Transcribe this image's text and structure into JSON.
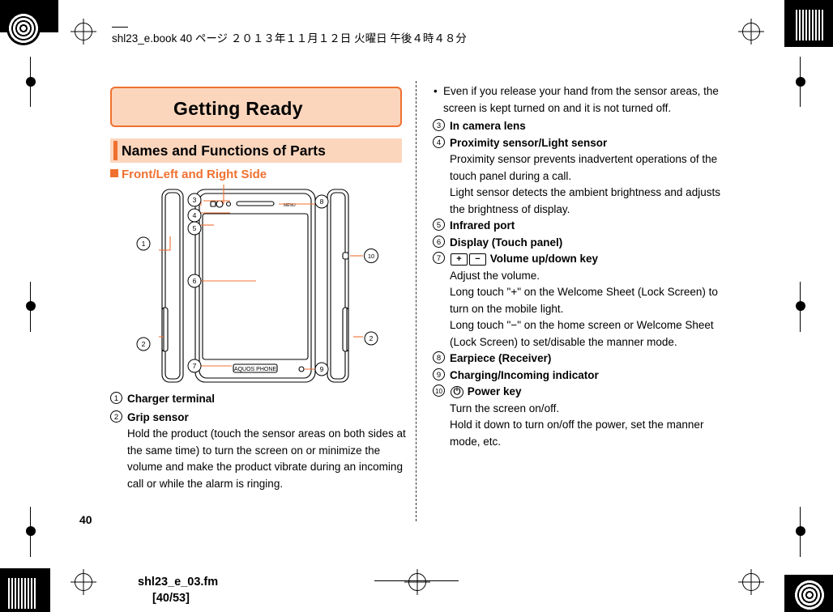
{
  "header": {
    "text": "shl23_e.book   40 ページ   ２０１３年１１月１２日   火曜日   午後４時４８分"
  },
  "chapter": {
    "title": "Getting Ready"
  },
  "section": {
    "title": "Names and Functions of Parts"
  },
  "subsection": {
    "title": "Front/Left and Right Side"
  },
  "figure": {
    "phone_label": "AQUOS PHONE",
    "callouts": [
      "1",
      "2",
      "3",
      "4",
      "5",
      "6",
      "7",
      "8",
      "9",
      "10"
    ]
  },
  "left_column": {
    "items": [
      {
        "num": "1",
        "title": "Charger terminal",
        "body": ""
      },
      {
        "num": "2",
        "title": "Grip sensor",
        "body": "Hold the product (touch the sensor areas on both sides at the same time) to turn the screen on or minimize the volume and make the product vibrate during an incoming call or while the alarm is ringing."
      }
    ]
  },
  "right_column": {
    "top_bullet": "Even if you release your hand from the sensor areas, the screen is kept turned on and it is not turned off.",
    "items": [
      {
        "num": "3",
        "title": "In camera lens",
        "lines": []
      },
      {
        "num": "4",
        "title": "Proximity sensor/Light sensor",
        "lines": [
          "Proximity sensor prevents inadvertent operations of the touch panel during a call.",
          "Light sensor detects the ambient brightness and adjusts the brightness of display."
        ]
      },
      {
        "num": "5",
        "title": "Infrared port",
        "lines": []
      },
      {
        "num": "6",
        "title": "Display (Touch panel)",
        "lines": []
      },
      {
        "num": "7",
        "title": "Volume up/down key",
        "keys": [
          "+",
          "−"
        ],
        "lines": [
          "Adjust the volume.",
          "Long touch \"+\" on the Welcome Sheet (Lock Screen) to turn on the mobile light.",
          "Long touch \"−\" on the home screen or Welcome Sheet (Lock Screen) to set/disable the manner mode."
        ]
      },
      {
        "num": "8",
        "title": "Earpiece (Receiver)",
        "lines": []
      },
      {
        "num": "9",
        "title": "Charging/Incoming indicator",
        "lines": []
      },
      {
        "num": "10",
        "title": "Power key",
        "keys": [
          "power"
        ],
        "lines": [
          "Turn the screen on/off.",
          "Hold it down to turn on/off the power, set the manner mode, etc."
        ]
      }
    ]
  },
  "page_number": "40",
  "footer": {
    "file": "shl23_e_03.fm",
    "page": "[40/53]"
  },
  "colors": {
    "accent": "#f07030",
    "banner_fill": "#fbd6bd",
    "text": "#000000"
  }
}
